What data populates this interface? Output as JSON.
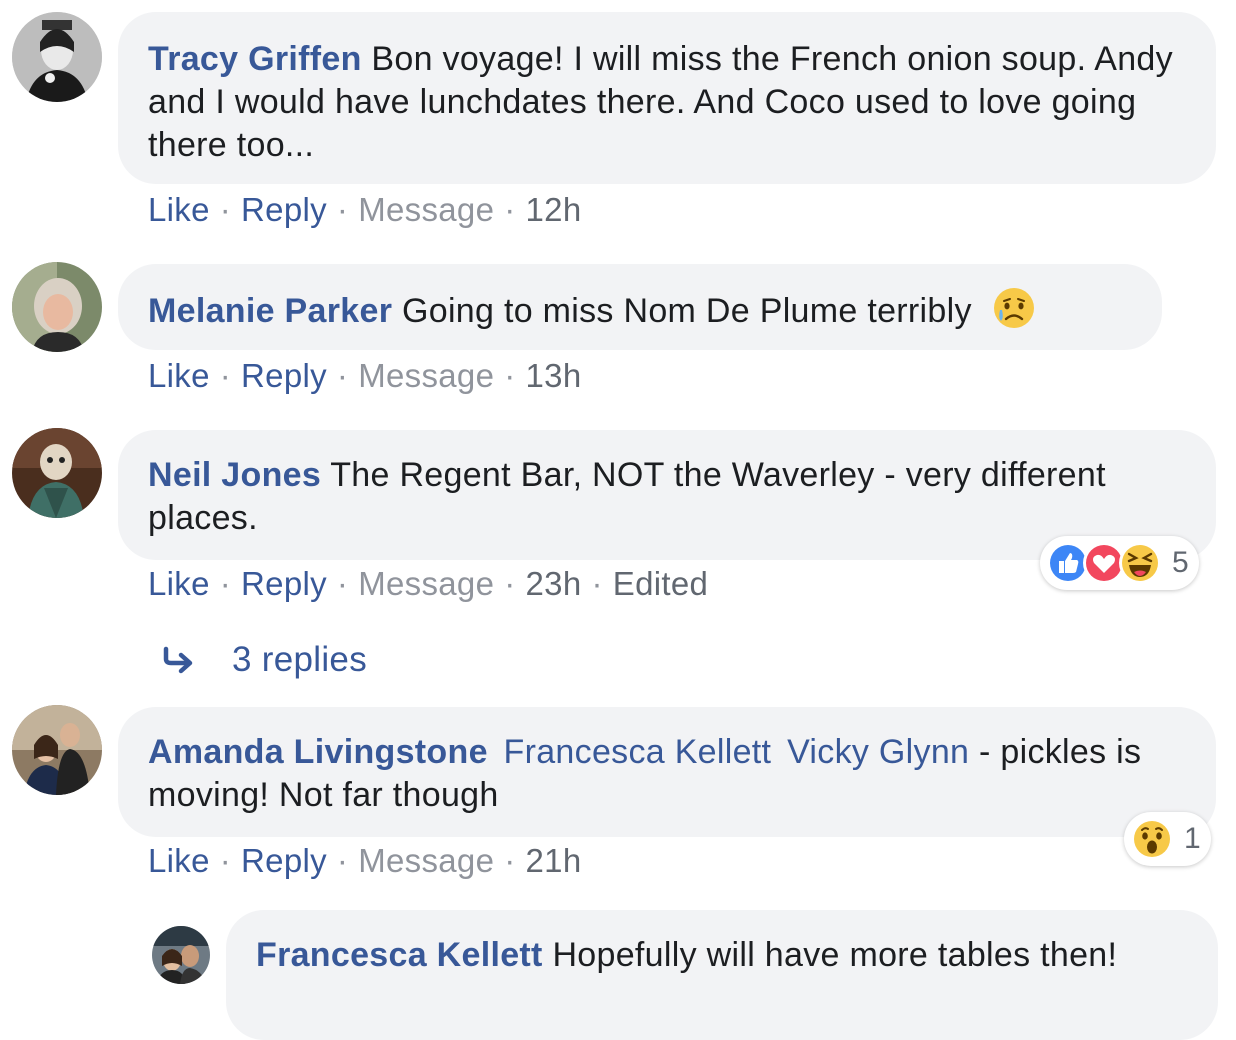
{
  "comments": [
    {
      "author": "Tracy Griffen",
      "text": "Bon voyage! I will miss the French onion soup. Andy and I would have lunchdates there. And Coco used to love going there too...",
      "actions": {
        "like": "Like",
        "reply": "Reply",
        "message": "Message",
        "time": "12h"
      }
    },
    {
      "author": "Melanie Parker",
      "text": "Going to miss Nom De Plume terribly",
      "emoji": "sad-tear-emoji",
      "actions": {
        "like": "Like",
        "reply": "Reply",
        "message": "Message",
        "time": "13h"
      }
    },
    {
      "author": "Neil Jones",
      "text": "The Regent Bar, NOT the Waverley - very different places.",
      "actions": {
        "like": "Like",
        "reply": "Reply",
        "message": "Message",
        "time": "23h",
        "edited": "Edited"
      },
      "reactions": {
        "icons": [
          "like-icon",
          "love-icon",
          "haha-icon"
        ],
        "count": "5"
      },
      "replies_link": "3 replies"
    },
    {
      "author": "Amanda Livingstone",
      "mentions": [
        "Francesca Kellett",
        "Vicky Glynn"
      ],
      "text_before": " -",
      "text": "pickles is moving! Not far though",
      "actions": {
        "like": "Like",
        "reply": "Reply",
        "message": "Message",
        "time": "21h"
      },
      "reactions": {
        "icons": [
          "wow-icon"
        ],
        "count": "1"
      }
    },
    {
      "author": "Francesca Kellett",
      "text": "Hopefully will have more tables then!"
    }
  ],
  "separator": "·",
  "colors": {
    "link": "#385898",
    "bubble": "#f2f3f5",
    "muted": "#90949c"
  }
}
